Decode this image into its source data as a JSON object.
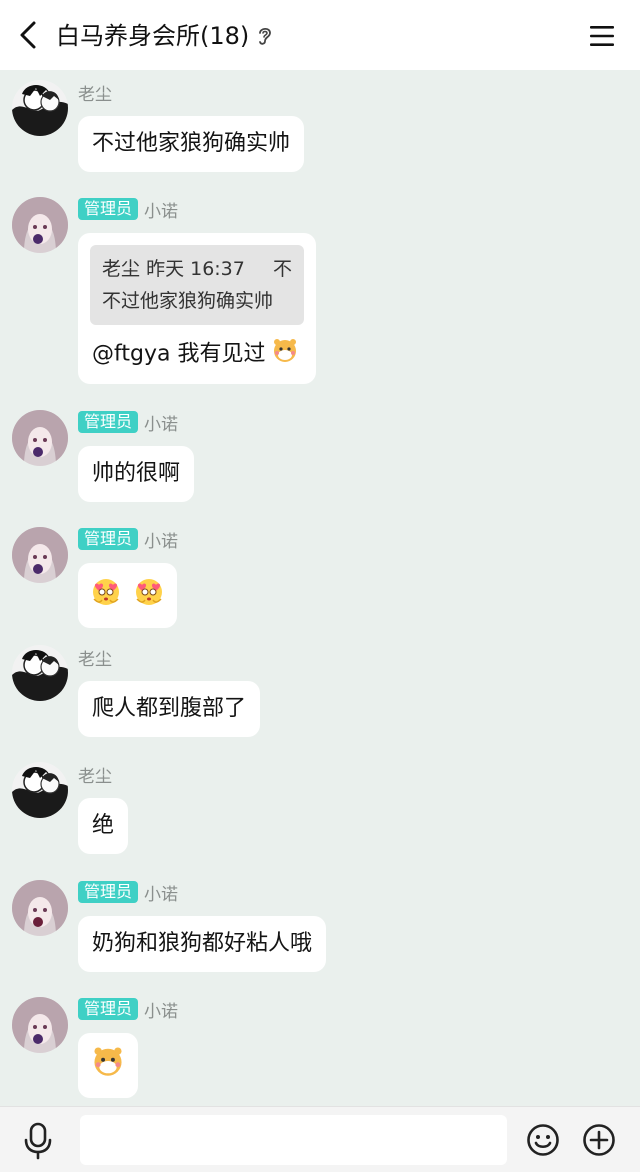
{
  "header": {
    "title": "白马养身会所(18)",
    "back_icon": "chevron-left-icon",
    "ear_icon": "ear-icon",
    "menu_icon": "hamburger-menu-icon"
  },
  "messages": [
    {
      "sender": "老尘",
      "badge": "",
      "avatar": "manga-bw-avatar",
      "text": "不过他家狼狗确实帅"
    },
    {
      "sender": "小诺",
      "badge": "管理员",
      "avatar": "anime-girl-avatar",
      "quote": {
        "author": "老尘",
        "time": "昨天 16:37",
        "text_start": "不",
        "text_rest": "不过他家狼狗确实帅"
      },
      "text": "@ftgya 我有见过",
      "emoji": "hamster-emoji"
    },
    {
      "sender": "小诺",
      "badge": "管理员",
      "avatar": "anime-girl-avatar",
      "text": "帅的很啊"
    },
    {
      "sender": "小诺",
      "badge": "管理员",
      "avatar": "anime-girl-avatar",
      "emoji": "heart-eyes-emoji x2"
    },
    {
      "sender": "老尘",
      "badge": "",
      "avatar": "manga-bw-avatar",
      "text": "爬人都到腹部了"
    },
    {
      "sender": "老尘",
      "badge": "",
      "avatar": "manga-bw-avatar",
      "text": "绝"
    },
    {
      "sender": "小诺",
      "badge": "管理员",
      "avatar": "anime-girl-avatar",
      "text": "奶狗和狼狗都好粘人哦"
    },
    {
      "sender": "小诺",
      "badge": "管理员",
      "avatar": "anime-girl-avatar",
      "emoji": "hamster-emoji"
    }
  ],
  "input": {
    "placeholder": "",
    "value": ""
  },
  "colors": {
    "badge": "#3fd0c5",
    "background": "#eaf0ed"
  }
}
